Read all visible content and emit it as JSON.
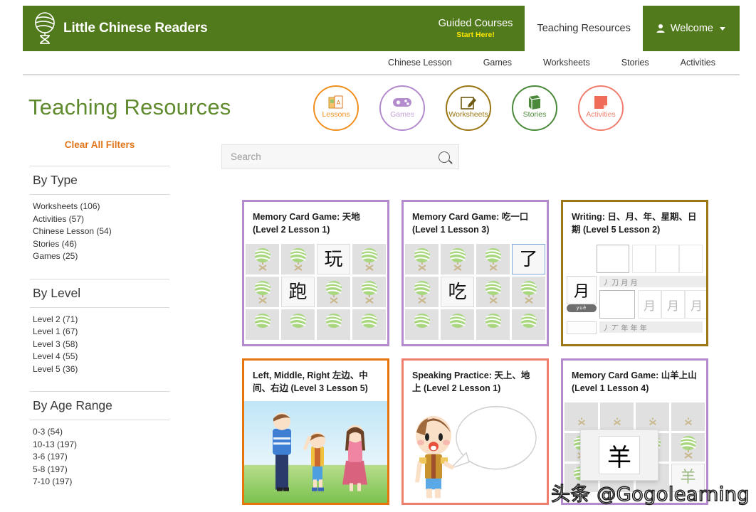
{
  "header": {
    "brand": "Little Chinese Readers",
    "logo_icon": "globe-ball-logo",
    "nav": [
      {
        "label": "Guided Courses",
        "sub": "Start Here!",
        "active": false
      },
      {
        "label": "Teaching Resources",
        "sub": "",
        "active": true
      }
    ],
    "welcome": {
      "label": "Welcome",
      "icon": "user-icon",
      "chevron": "chevron-down-icon"
    }
  },
  "subnav": {
    "items": [
      "Chinese Lesson",
      "Games",
      "Worksheets",
      "Stories",
      "Activities"
    ]
  },
  "page": {
    "title": "Teaching Resources",
    "title_color": "#5f8a2e"
  },
  "categories": [
    {
      "label": "Lessons",
      "icon": "flashcards-icon",
      "color": "#ef9021"
    },
    {
      "label": "Games",
      "icon": "gamepad-icon",
      "color": "#b48ccd"
    },
    {
      "label": "Worksheets",
      "icon": "pencil-square-icon",
      "color": "#9a7714"
    },
    {
      "label": "Stories",
      "icon": "book-icon",
      "color": "#4b8a3a"
    },
    {
      "label": "Activities",
      "icon": "sticky-note-icon",
      "color": "#ef7e6e"
    }
  ],
  "search": {
    "placeholder": "Search",
    "value": "",
    "icon": "search-icon"
  },
  "filters": {
    "clear_label": "Clear All Filters",
    "groups": [
      {
        "title": "By Type",
        "items": [
          "Worksheets (106)",
          "Activities (57)",
          "Chinese Lesson (54)",
          "Stories (46)",
          "Games (25)"
        ]
      },
      {
        "title": "By Level",
        "items": [
          "Level 2 (71)",
          "Level 1 (67)",
          "Level 3 (58)",
          "Level 4 (55)",
          "Level 5 (36)"
        ]
      },
      {
        "title": "By Age Range",
        "items": [
          "0-3 (54)",
          "10-13 (197)",
          "3-6 (197)",
          "5-8 (197)",
          "7-10 (197)"
        ]
      }
    ]
  },
  "cards": [
    {
      "title": "Memory Card Game: 天地 (Level 2 Lesson 1)",
      "border_color": "#b48ccd",
      "thumb_type": "memory-grid",
      "faces": {
        "2": "玩",
        "5": "跑"
      },
      "selected_index": -1
    },
    {
      "title": "Memory Card Game: 吃一口 (Level 1 Lesson 3)",
      "border_color": "#b48ccd",
      "thumb_type": "memory-grid",
      "faces": {
        "3": "了",
        "5": "吃"
      },
      "selected_index": 3
    },
    {
      "title": "Writing: 日、月、年、星期、日期 (Level 5 Lesson 2)",
      "border_color": "#9a7714",
      "thumb_type": "writing-worksheet",
      "worksheet": {
        "character": "月",
        "pinyin": "yuè",
        "strokes": "丿 刀 月 月",
        "practice": [
          "月",
          "月",
          "月"
        ]
      }
    },
    {
      "title": "Left, Middle, Right 左边、中间、右边 (Level 3 Lesson 5)",
      "border_color": "#e8740c",
      "thumb_type": "illustration-three-people"
    },
    {
      "title": "Speaking Practice: 天上、地上 (Level 2 Lesson 1)",
      "border_color": "#ef7e6e",
      "thumb_type": "illustration-speech-bubble"
    },
    {
      "title": "Memory Card Game: 山羊上山 (Level 1 Lesson 4)",
      "border_color": "#b48ccd",
      "thumb_type": "memory-grid-popup",
      "popup_char": "羊",
      "side_char": "羊"
    }
  ],
  "watermark": {
    "text": "头条 @Gogolearning"
  }
}
